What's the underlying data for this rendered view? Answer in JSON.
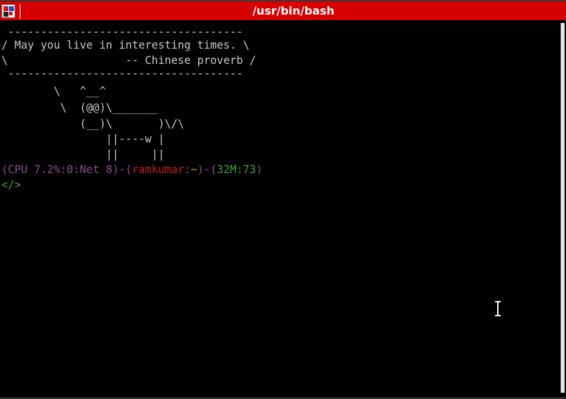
{
  "window": {
    "title": "/usr/bin/bash",
    "icon": "terminal-app-icon"
  },
  "terminal": {
    "fortune": [
      " ------------------------------------",
      "/ May you live in interesting times. \\",
      "\\                  -- Chinese proverb /",
      " ------------------------------------"
    ],
    "cowsay": [
      "        \\   ^__^",
      "         \\  (@@)\\_______",
      "            (__)\\       )\\/\\",
      "                ||----w |",
      "                ||     ||"
    ],
    "status": {
      "open": "(",
      "cpu": "CPU 7.2%:0:Net 8",
      "sep1": ")-(",
      "user": "ramkumar",
      "colon": ":",
      "path": "~",
      "sep2": ")-(",
      "mem": "32M:73",
      "close": ")"
    },
    "prompt": "</>"
  },
  "colors": {
    "titlebar": "#d60000",
    "background": "#000000",
    "text": "#c8c8c8",
    "purple": "#8d4b91",
    "red": "#c81818",
    "yellow": "#c8a000",
    "green": "#3ea33e"
  }
}
